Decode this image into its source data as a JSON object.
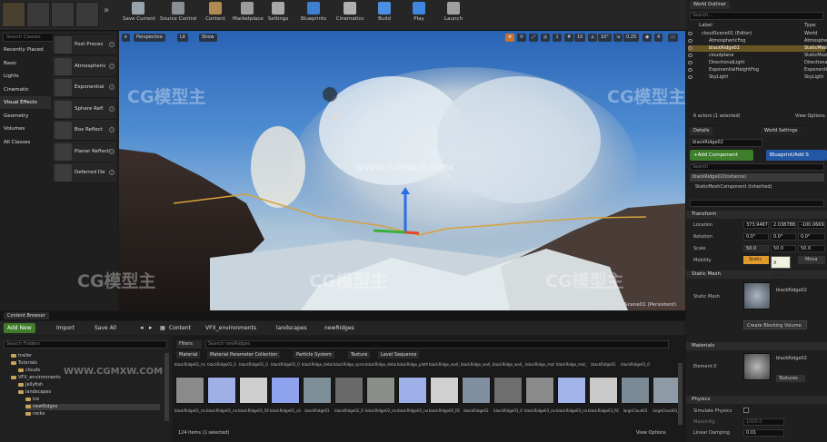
{
  "toolbar": {
    "buttons": [
      {
        "label": "Save Current",
        "icon": "save-icon",
        "color": "#9aa3ad"
      },
      {
        "label": "Source Control",
        "icon": "source-control-icon",
        "color": "#8a8f96"
      },
      {
        "label": "Content",
        "icon": "content-icon",
        "color": "#b08a50"
      },
      {
        "label": "Marketplace",
        "icon": "marketplace-icon",
        "color": "#9c9c9c"
      },
      {
        "label": "Settings",
        "icon": "settings-icon",
        "color": "#a8a8a8"
      },
      {
        "label": "Blueprints",
        "icon": "blueprints-icon",
        "color": "#3f7fd0"
      },
      {
        "label": "Cinematics",
        "icon": "cinematics-icon",
        "color": "#b0b0b0"
      },
      {
        "label": "Build",
        "icon": "build-icon",
        "color": "#4b8fe0"
      },
      {
        "label": "Play",
        "icon": "play-icon",
        "color": "#3f86e0"
      },
      {
        "label": "Launch",
        "icon": "launch-icon",
        "color": "#a0a0a0"
      }
    ]
  },
  "place": {
    "search_placeholder": "Search Classes",
    "categories": [
      "Recently Placed",
      "Basic",
      "Lights",
      "Cinematic",
      "Visual Effects",
      "Geometry",
      "Volumes",
      "All Classes"
    ],
    "active_category": "Visual Effects",
    "items": [
      "Post Proces",
      "Atmospheric",
      "Exponential",
      "Sphere Refl",
      "Box Reflect",
      "Planar Reflecti",
      "Deferred De"
    ]
  },
  "viewport": {
    "perspective": "Perspective",
    "lit": "Lit",
    "show": "Show",
    "grid_snap": "10",
    "rot_snap": "10°",
    "scale_snap": "0.25",
    "cam_speed": "4",
    "level_label": "Level: cloudScene01 (Persistent)"
  },
  "outliner": {
    "tab": "World Outliner",
    "search_placeholder": "Search...",
    "col_label": "Label",
    "col_type": "Type",
    "rows": [
      {
        "label": "cloudScene01 (Editor)",
        "type": "World",
        "selected": false,
        "indent": 0
      },
      {
        "label": "AtmosphericFog",
        "type": "AtmosphericF",
        "selected": false,
        "indent": 1
      },
      {
        "label": "blackRidge02",
        "type": "StaticMesh",
        "selected": true,
        "indent": 1
      },
      {
        "label": "cloudplane",
        "type": "StaticMesh",
        "selected": false,
        "indent": 1
      },
      {
        "label": "DirectionalLight",
        "type": "DirectionalL",
        "selected": false,
        "indent": 1
      },
      {
        "label": "ExponentialHeightFog",
        "type": "Exponential",
        "selected": false,
        "indent": 1
      },
      {
        "label": "SkyLight",
        "type": "SkyLight",
        "selected": false,
        "indent": 1
      }
    ],
    "summary": "6 actors (1 selected)",
    "view_options": "View Options"
  },
  "details": {
    "tab": "Details",
    "tab2": "World Settings",
    "name": "blackRidge02",
    "add_component": "+Add Component",
    "blueprint": "Blueprint/Add S",
    "search_placeholder": "Search",
    "instance": "blackRidge02(Instance)",
    "component": "StaticMeshComponent (Inherited)",
    "transform_header": "Transform",
    "location_label": "Location",
    "location": [
      "373.94675",
      "2.038788",
      "-100.06690"
    ],
    "rotation_label": "Rotation",
    "rotation": [
      "0.0°",
      "0.0°",
      "0.0°"
    ],
    "scale_label": "Scale",
    "scale": [
      "50.0",
      "50.0",
      "50.0"
    ],
    "mobility_label": "Mobility",
    "mobility_value": "Static",
    "mobility_move": "Mova",
    "tooltip": "X Value",
    "static_mesh_header": "Static Mesh",
    "static_mesh_label": "Static Mesh",
    "static_mesh_value": "blackRidge02",
    "create_volume": "Create Blocking Volume",
    "materials_header": "Materials",
    "element_label": "Element 0",
    "element_value": "blackRidge02",
    "textures": "Textures",
    "physics_header": "Physics",
    "simulate": "Simulate Physics",
    "mass_label": "MassInKg",
    "mass_value": "1000.0",
    "linear_damping": "Linear Damping",
    "linear_damping_value": "0.01"
  },
  "content_browser": {
    "title": "Content Browser",
    "add_new": "Add New",
    "import": "Import",
    "save_all": "Save All",
    "path": [
      "Content",
      "VFX_environments",
      "landscapes",
      "newRidges"
    ],
    "search_folders": "Search Folders",
    "filters": "Filters",
    "search_placeholder": "Search newRidges",
    "filter_tags": [
      "Material",
      "Material Parameter Collection",
      "Particle System",
      "Texture",
      "Level Sequence"
    ],
    "tree": [
      {
        "label": "trailer",
        "indent": 1,
        "selected": false
      },
      {
        "label": "Tutorials",
        "indent": 1,
        "selected": false
      },
      {
        "label": "clouds",
        "indent": 2,
        "selected": false
      },
      {
        "label": "VFX_environments",
        "indent": 1,
        "selected": false
      },
      {
        "label": "Jellyfish",
        "indent": 2,
        "selected": false
      },
      {
        "label": "landscapes",
        "indent": 2,
        "selected": false
      },
      {
        "label": "ice",
        "indent": 3,
        "selected": false
      },
      {
        "label": "newRidges",
        "indent": 3,
        "selected": true
      },
      {
        "label": "rocks",
        "indent": 3,
        "selected": false
      }
    ],
    "top_labels": [
      "blackRidge01_mat",
      "blackRidge01_0",
      "blackRidge01_0",
      "blackRidge01_0",
      "blackRidge_detail_a",
      "blackRidge_sprang_b",
      "blackRidge_detail_a",
      "blackRidge_platform_a",
      "blackRidge_wall_a",
      "blackRidge_wall_b",
      "blackRidge_wall_c",
      "blackRidge_mat",
      "blackRidge_mat_b",
      "blackRidge01",
      "blackRidge01_0"
    ],
    "tiles": [
      {
        "label": "blackRidge01_mat",
        "color": "#8a8a8a"
      },
      {
        "label": "blackRidge01_normals",
        "color": "#9fb0e8"
      },
      {
        "label": "blackRidge01_RGBA",
        "color": "#cfcfcf"
      },
      {
        "label": "blackRidge01_clone_normals",
        "color": "#8ea2ee"
      },
      {
        "label": "blackRidge01",
        "color": "#7f8f99"
      },
      {
        "label": "blackRidge02_0",
        "color": "#6a6a6a"
      },
      {
        "label": "blackRidge02_mat",
        "color": "#8a8f8a"
      },
      {
        "label": "blackRidge02_normals",
        "color": "#9fb0e8"
      },
      {
        "label": "blackRidge02_RGBA",
        "color": "#d0d0d0"
      },
      {
        "label": "blackRidge03",
        "color": "#8090a0"
      },
      {
        "label": "blackRidge03_0",
        "color": "#6e6e6e"
      },
      {
        "label": "blackRidge03_mat",
        "color": "#8a8a8a"
      },
      {
        "label": "blackRidge03_normals",
        "color": "#a3b4ea"
      },
      {
        "label": "blackRidge03_RGBA",
        "color": "#cacaca"
      },
      {
        "label": "largeCloud03",
        "color": "#7a8a96"
      },
      {
        "label": "largeCloud03_0",
        "color": "#8e9aa6"
      }
    ],
    "count": "124 items (1 selected)",
    "view_options": "View Options"
  },
  "watermarks": [
    "CG模型主",
    "CG模型主",
    "CG模型主",
    "CG模型主",
    "CG模型主",
    "WWW.CGMXW.COM",
    "WWW.CGMXW.COM"
  ]
}
